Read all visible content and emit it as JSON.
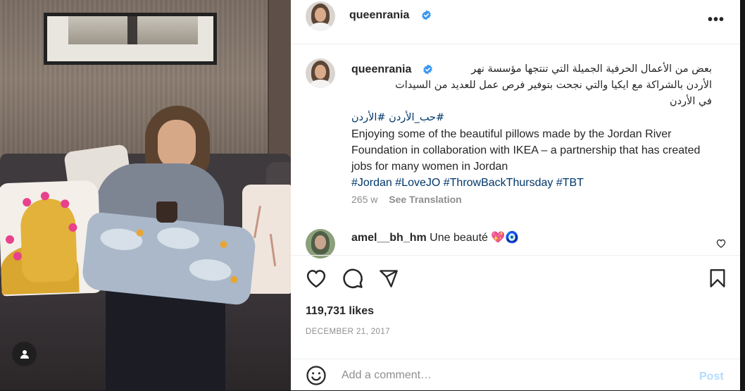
{
  "post": {
    "username": "queenrania",
    "verified": true,
    "caption": {
      "arabic_line1": "بعض من الأعمال الحرفية الجميلة التي تنتجها مؤسسة نهر",
      "arabic_line2": "الأردن بالشراكة مع ايكيا والتي نجحت بتوفير فرص عمل للعديد من السيدات",
      "arabic_line3": "في الأردن",
      "arabic_hashtags": "#حب_الأردن #الأردن",
      "english": "Enjoying some of the beautiful pillows made by the Jordan River Foundation in collaboration with IKEA – a partnership that has created jobs for many women in Jordan",
      "english_hashtags": "#Jordan #LoveJO #ThrowBackThursday #TBT"
    },
    "age": "265 w",
    "see_translation": "See Translation",
    "likes": "119,731 likes",
    "date": "DECEMBER 21, 2017"
  },
  "comments": [
    {
      "username": "amel__bh_hm",
      "text": "Une beauté 💖🧿"
    }
  ],
  "actions": {
    "like_icon": "heart-icon",
    "comment_icon": "comment-icon",
    "share_icon": "send-icon",
    "save_icon": "bookmark-icon"
  },
  "add_comment": {
    "placeholder": "Add a comment…",
    "post_label": "Post"
  },
  "colors": {
    "verified_blue": "#3897f0",
    "hashtag": "#00376b",
    "post_disabled": "#b3dbff"
  }
}
